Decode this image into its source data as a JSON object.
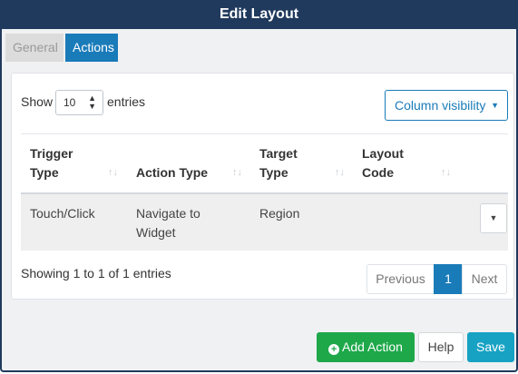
{
  "dialog": {
    "title": "Edit Layout"
  },
  "tabs": [
    {
      "label": "General",
      "active": false
    },
    {
      "label": "Actions",
      "active": true
    }
  ],
  "table_controls": {
    "show_label": "Show",
    "entries_value": "10",
    "entries_label": "entries",
    "column_visibility_label": "Column visibility"
  },
  "table": {
    "columns": [
      {
        "line1": "Trigger",
        "line2": "Type"
      },
      {
        "line1": "Action Type",
        "line2": ""
      },
      {
        "line1": "Target",
        "line2": "Type"
      },
      {
        "line1": "Layout",
        "line2": "Code"
      }
    ],
    "rows": [
      {
        "trigger_type": "Touch/Click",
        "action_line1": "Navigate to",
        "action_line2": "Widget",
        "target_type": "Region",
        "layout_code": ""
      }
    ]
  },
  "footer": {
    "info": "Showing 1 to 1 of 1 entries",
    "prev_label": "Previous",
    "current_page": "1",
    "next_label": "Next"
  },
  "buttons": {
    "add_action": "Add Action",
    "help": "Help",
    "save": "Save"
  },
  "colors": {
    "titlebar": "#203a5d",
    "accent": "#1a7bb9",
    "success": "#1ea84a",
    "info": "#17a2c4"
  },
  "icons": {
    "add": "plus-circle-icon",
    "sort": "sort-icon",
    "caret": "caret-down-icon"
  }
}
